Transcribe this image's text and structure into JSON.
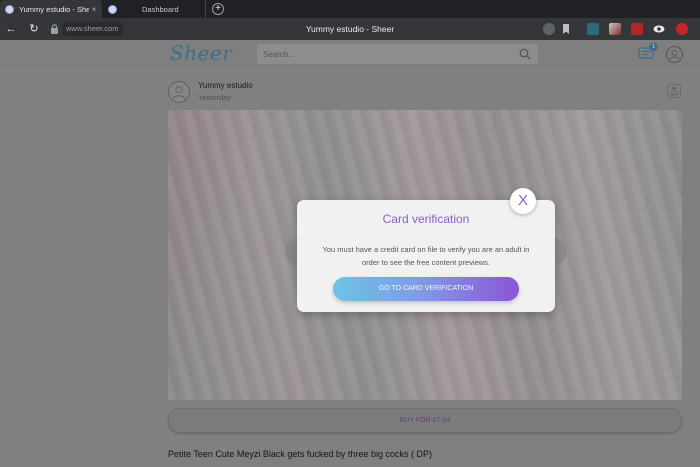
{
  "browser": {
    "tabs": [
      {
        "title": "Yummy estudio - Sheer",
        "active": true,
        "close": "×"
      },
      {
        "title": "Dashboard",
        "active": false
      }
    ],
    "new_tab_symbol": "+",
    "url": "www.sheer.com",
    "window_title": "Yummy estudio - Sheer",
    "nav": {
      "back": "←",
      "reload": "↻"
    }
  },
  "site": {
    "logo": "Sheer",
    "search_placeholder": "Search...",
    "notification_count": "1"
  },
  "post": {
    "author": "Yummy estudio",
    "date": "Yesterday",
    "buy_label": "BUY FOR £7.04",
    "title": "Petite Teen Cute Meyzi Black gets fucked by three big cocks ( DP)"
  },
  "modal": {
    "title": "Card verification",
    "message": "You must have a credit card on file to verify you are an adult in order to see the free content previews.",
    "cta": "GO TO CARD VERIFICATION",
    "close": "X"
  },
  "colors": {
    "accent_purple": "#8a5ec7",
    "gradient_start": "#6cc3e6",
    "gradient_end": "#8c55d7",
    "browser_dark": "#202124"
  }
}
